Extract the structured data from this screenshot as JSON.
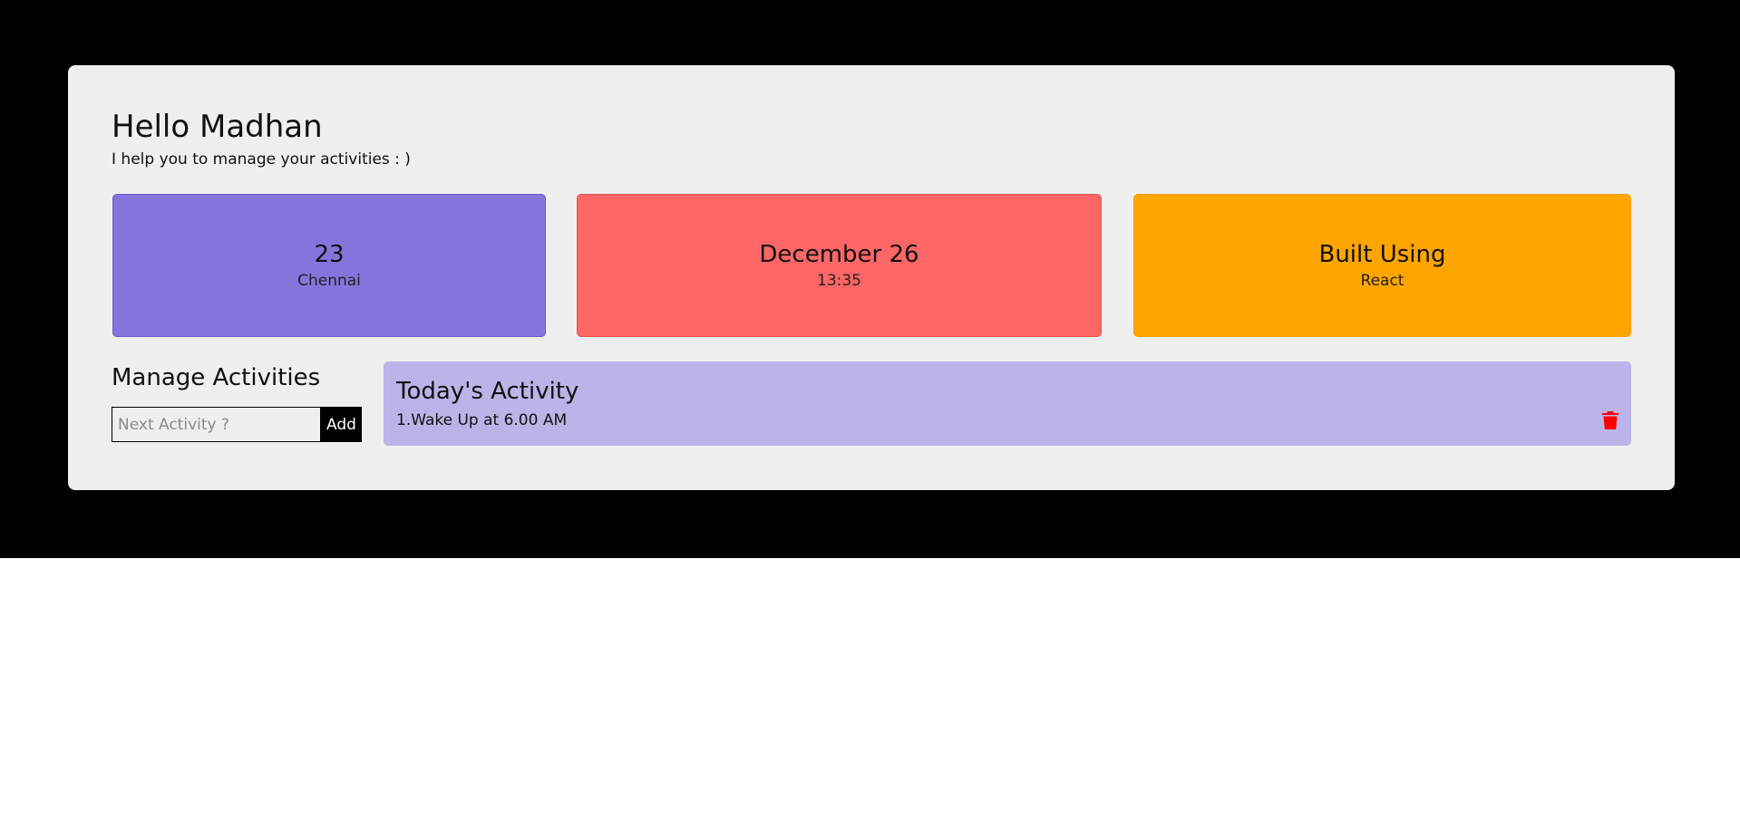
{
  "header": {
    "greeting": "Hello Madhan",
    "subtitle": "I help you to manage your activities : )"
  },
  "tiles": [
    {
      "primary": "23",
      "secondary": "Chennai",
      "color": "#8475dc"
    },
    {
      "primary": "December 26",
      "secondary": "13:35",
      "color": "#ff6666"
    },
    {
      "primary": "Built Using",
      "secondary": "React",
      "color": "#ffa500"
    }
  ],
  "manage": {
    "title": "Manage Activities",
    "input_placeholder": "Next Activity ?",
    "input_value": "",
    "add_label": "Add"
  },
  "activity_panel": {
    "title": "Today's Activity",
    "color": "#bcb3e8",
    "items": [
      {
        "text": "1.Wake Up at 6.00 AM",
        "icon": "trash-icon",
        "icon_color": "#ff0000"
      }
    ]
  },
  "colors": {
    "page_band": "#000000",
    "card_background": "#efefef",
    "button_background": "#000000"
  }
}
